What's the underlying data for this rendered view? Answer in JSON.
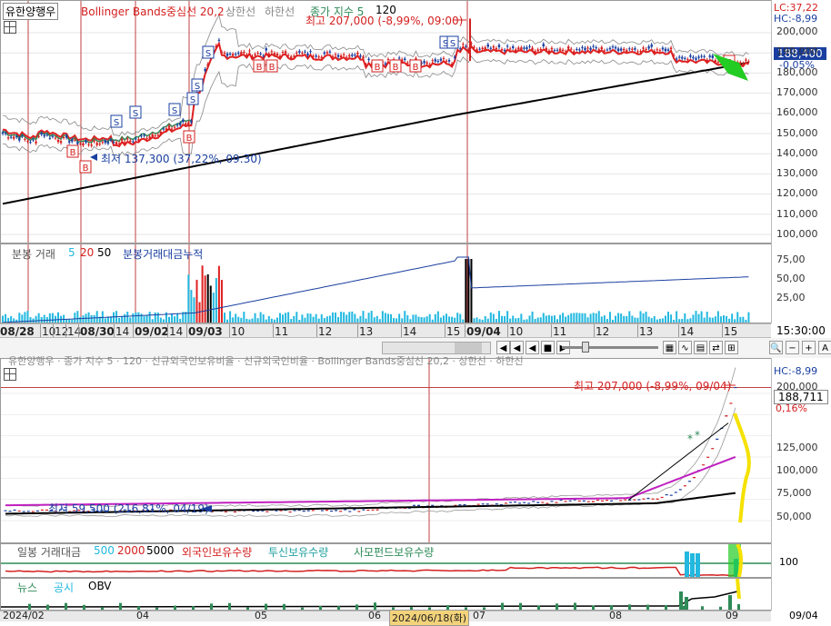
{
  "top_chart": {
    "symbol_label": "유한양행우",
    "legend": {
      "bollinger": "Bollinger Bands중심선 20,2",
      "upper": "상한선",
      "lower": "하한선",
      "index": "종가 지수 5",
      "period": "120"
    },
    "lc": "LC:37,22",
    "hc": "HC:-8,99",
    "max_annotation": "최고 207,000 (-8,99%, 09:00)",
    "min_annotation": "최저 137,300 (37,22%, 09:30)",
    "price_badge": "188,400",
    "pct_badge": "-0,05%",
    "y_ticks": [
      "200,000",
      "190,000",
      "180,000",
      "170,000",
      "160,000",
      "150,000",
      "140,000",
      "130,000",
      "120,000",
      "110,000",
      "100,000"
    ]
  },
  "top_volume": {
    "legend_label": "분봉 거래",
    "ma1": "5",
    "ma2": "20",
    "ma3": "50",
    "cumulative": "분봉거래대금누적",
    "y_ticks": [
      "75,00",
      "50,00",
      "25,00"
    ]
  },
  "top_dates": [
    "08/28",
    "10",
    "12",
    "14",
    "08/30",
    "14",
    "09/02",
    "14",
    "09/03",
    "10",
    "11",
    "12",
    "13",
    "14",
    "15",
    "09/04",
    "10",
    "11",
    "12",
    "13",
    "14",
    "15"
  ],
  "top_time": "15:30:00",
  "toolbar_icons": [
    "scroll-left",
    "first",
    "prev",
    "stop",
    "next",
    "zoom-slider",
    "bar-style",
    "line-style",
    "multi",
    "sync",
    "search",
    "zoom-out",
    "zoom-in",
    "font-size"
  ],
  "toolbar_glyphs": [
    "◀",
    "◀◀",
    "◀",
    "■",
    "▶",
    "",
    "",
    "",
    "",
    "",
    "🔍",
    "−",
    "+",
    "A"
  ],
  "bottom_chart": {
    "legend_cut": "유한양행우 · 종가 지수 5 · 120 · 신규외국인보유비율 · 신규외국인비율 · Bollinger Bands중심선 20,2 · 상한선 · 하한선",
    "hc": "HC:-8,99",
    "max_annotation": "최고 207,000 (-8,99%, 09/04)",
    "min_annotation": "최저 59,500 (216,81%, 04/19)",
    "price_badge": "188,711",
    "pct_badge": "0,16%",
    "y_ticks": [
      "200,000",
      "150,000",
      "125,000",
      "100,000",
      "75,000",
      "50,000"
    ]
  },
  "bottom_volume": {
    "legend_label": "일봉 거래대금",
    "ma1": "500",
    "ma2": "2000",
    "ma3": "5000",
    "foreign": "외국인보유수량",
    "trust": "투신보유수량",
    "private_fund": "사모펀드보유수량",
    "y_tick": "100"
  },
  "bottom_news": {
    "news": "뉴스",
    "disclosure": "공시",
    "obv": "OBV"
  },
  "bottom_dates": [
    "2024/02",
    "04",
    "05",
    "06",
    "2024/06/18(화)",
    "07",
    "08",
    "09",
    "09/04"
  ],
  "colors": {
    "up": "#d42020",
    "down": "#1a3fa0",
    "bollinger_mid": "#e02020",
    "ma_black": "#000000",
    "ma_green": "#2e8b57",
    "volume_cyan": "#22b8e0",
    "volume_red": "#e02020",
    "volume_black": "#000000",
    "grid": "#d8d8d8",
    "highlight_yellow": "#f5e100",
    "highlight_green": "#22cc22",
    "purple": "#c020c0",
    "date_tag_bg": "#f3d37a"
  }
}
